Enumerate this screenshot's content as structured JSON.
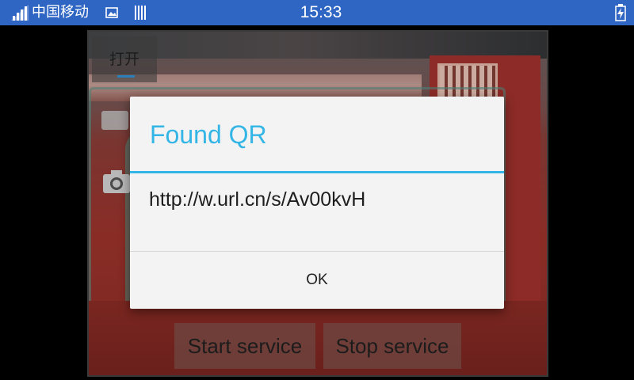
{
  "status_bar": {
    "carrier": "中国移动",
    "time": "15:33",
    "background": "#2f66c4",
    "icons": [
      "signal-icon",
      "gallery-icon",
      "bars-icon",
      "battery-charging-icon"
    ]
  },
  "app": {
    "open_button_label": "打开",
    "start_service_label": "Start service",
    "stop_service_label": "Stop service"
  },
  "dialog": {
    "title": "Found QR",
    "message": "http://w.url.cn/s/Av00kvH",
    "ok_label": "OK",
    "accent_color": "#33b5e5"
  }
}
